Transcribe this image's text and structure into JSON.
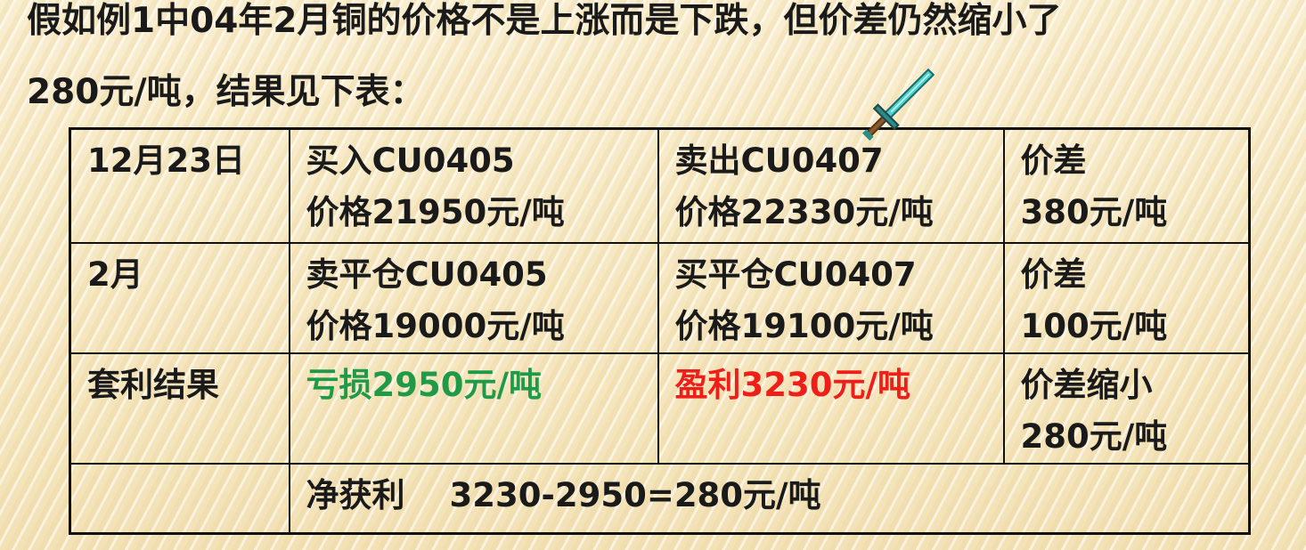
{
  "heading": {
    "line1": "假如例1中04年2月铜的价格不是上涨而是下跌，但价差仍然缩小了",
    "line2": "280元/吨，结果见下表："
  },
  "table": {
    "rows": [
      {
        "date": "12月23日",
        "buy": {
          "action": "买入CU0405",
          "price": "价格21950元/吨"
        },
        "sell": {
          "action": "卖出CU0407",
          "price": "价格22330元/吨"
        },
        "spread": {
          "label": "价差",
          "value": "380元/吨"
        }
      },
      {
        "date": "2月",
        "buy": {
          "action": "卖平仓CU0405",
          "price": "价格19000元/吨"
        },
        "sell": {
          "action": "买平仓CU0407",
          "price": "价格19100元/吨"
        },
        "spread": {
          "label": "价差",
          "value": "100元/吨"
        }
      }
    ],
    "result": {
      "label": "套利结果",
      "loss": "亏损2950元/吨",
      "profit": "盈利3230元/吨",
      "spread_label": "价差缩小",
      "spread_value": "280元/吨"
    },
    "net": {
      "label": "净获利",
      "value": "3230-2950=280元/吨"
    }
  },
  "colors": {
    "loss": "#1f9a48",
    "profit": "#ee1e18",
    "background": "#f6e9c4"
  },
  "cursor_icon": "diamond-sword-icon"
}
